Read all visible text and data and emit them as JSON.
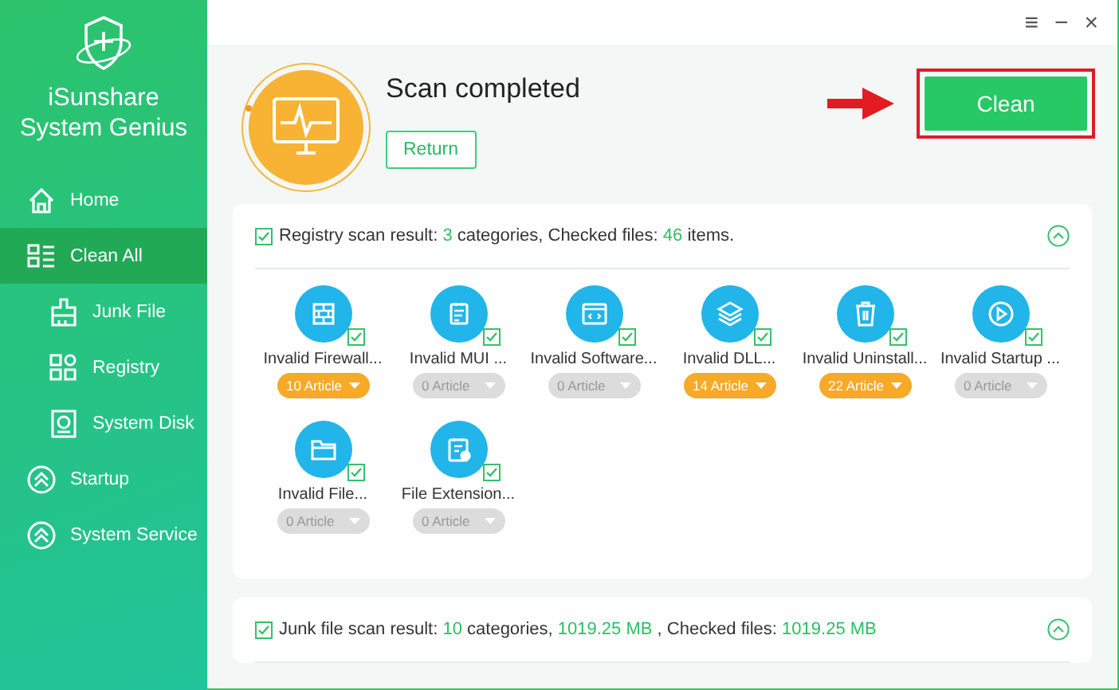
{
  "app": {
    "name_line1": "iSunshare",
    "name_line2": "System Genius"
  },
  "sidebar": {
    "items": [
      {
        "label": "Home",
        "selected": false
      },
      {
        "label": "Clean All",
        "selected": true,
        "children": [
          {
            "label": "Junk File",
            "selected": false
          },
          {
            "label": "Registry",
            "selected": false
          },
          {
            "label": "System Disk",
            "selected": false
          }
        ]
      },
      {
        "label": "Startup",
        "selected": false
      },
      {
        "label": "System Service",
        "selected": false
      }
    ]
  },
  "window_controls": [
    "≡",
    "−",
    "×"
  ],
  "header": {
    "title": "Scan completed",
    "return_button": "Return",
    "clean_button": "Clean",
    "clean_highlighted": true
  },
  "cards": [
    {
      "checked": true,
      "expanded": true,
      "summary": [
        {
          "text": "Registry scan result: ",
          "kind": "plain"
        },
        {
          "text": "3",
          "kind": "number"
        },
        {
          "text": " categories, Checked files: ",
          "kind": "plain"
        },
        {
          "text": "46",
          "kind": "number"
        },
        {
          "text": " items.",
          "kind": "plain"
        }
      ],
      "items": [
        {
          "label": "Invalid Firewall...",
          "count": "10 Article",
          "checked": true,
          "active": true
        },
        {
          "label": "Invalid MUI ...",
          "count": "0 Article",
          "checked": true,
          "active": false
        },
        {
          "label": "Invalid Software...",
          "count": "0 Article",
          "checked": true,
          "active": false
        },
        {
          "label": "Invalid DLL...",
          "count": "14 Article",
          "checked": true,
          "active": true
        },
        {
          "label": "Invalid Uninstall...",
          "count": "22 Article",
          "checked": true,
          "active": true
        },
        {
          "label": "Invalid Startup ...",
          "count": "0 Article",
          "checked": true,
          "active": false
        },
        {
          "label": "Invalid File...",
          "count": "0 Article",
          "checked": true,
          "active": false
        },
        {
          "label": "File Extension...",
          "count": "0 Article",
          "checked": true,
          "active": false
        }
      ]
    },
    {
      "checked": true,
      "expanded": true,
      "summary": [
        {
          "text": "Junk file scan result: ",
          "kind": "plain"
        },
        {
          "text": "10",
          "kind": "number"
        },
        {
          "text": " categories, ",
          "kind": "plain"
        },
        {
          "text": "1019.25 MB",
          "kind": "number"
        },
        {
          "text": " , Checked files: ",
          "kind": "plain"
        },
        {
          "text": "1019.25 MB",
          "kind": "number"
        }
      ]
    }
  ]
}
